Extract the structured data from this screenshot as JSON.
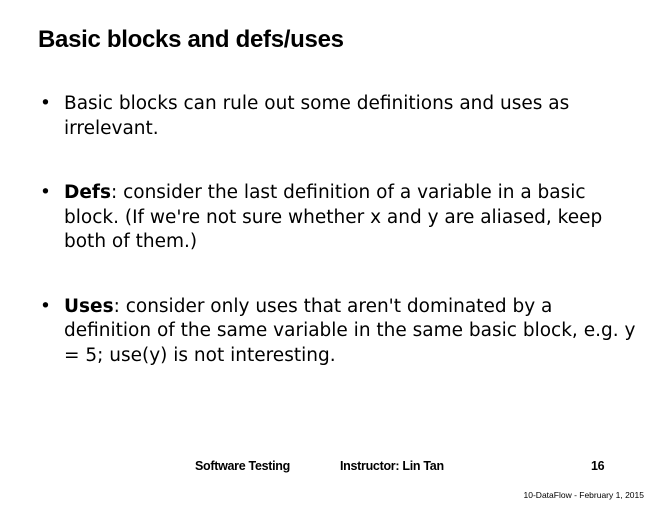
{
  "slide": {
    "title": "Basic blocks and defs/uses",
    "bullets": [
      {
        "term": "",
        "text": "Basic blocks can rule out some definitions and uses as irrelevant."
      },
      {
        "term": "Defs",
        "text": ": consider the last definition of a variable in a basic block. (If we're not sure whether x and y are aliased, keep both of them.)"
      },
      {
        "term": "Uses",
        "text": ": consider only uses that aren't dominated by a definition of the same variable in the same basic block, e.g. y = 5; use(y) is not interesting."
      }
    ],
    "bullet_symbol": "•"
  },
  "footer": {
    "course": "Software Testing",
    "instructor": "Instructor: Lin Tan",
    "page_number": "16",
    "date_label": "10-DataFlow - February 1, 2015"
  }
}
